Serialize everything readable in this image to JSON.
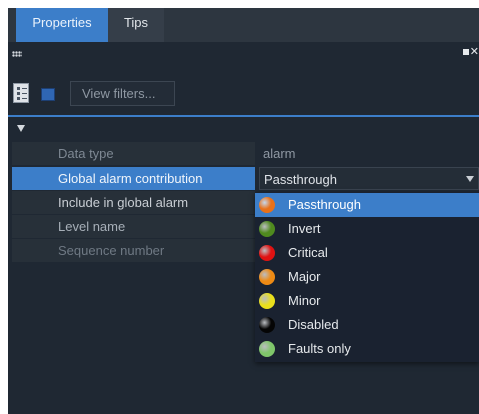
{
  "tabs": [
    {
      "label": "Properties",
      "active": true
    },
    {
      "label": "Tips",
      "active": false
    }
  ],
  "toolbar": {
    "view_filters_label": "View filters..."
  },
  "properties": [
    {
      "label": "Data type",
      "value": "alarm"
    },
    {
      "label": "Global alarm contribution",
      "value": "Passthrough"
    },
    {
      "label": "Include in global alarm",
      "value": ""
    },
    {
      "label": "Level name",
      "value": ""
    },
    {
      "label": "Sequence number",
      "value": ""
    }
  ],
  "dropdown": {
    "selected": "Passthrough",
    "options": [
      {
        "label": "Passthrough",
        "color": "#e8711a"
      },
      {
        "label": "Invert",
        "color": "#4f8a1e"
      },
      {
        "label": "Critical",
        "color": "#e01212"
      },
      {
        "label": "Major",
        "color": "#ee8a14"
      },
      {
        "label": "Minor",
        "color": "#e9df1c"
      },
      {
        "label": "Disabled",
        "color": "#050505"
      },
      {
        "label": "Faults only",
        "color": "#7fc66a"
      }
    ]
  },
  "colors": {
    "accent": "#3c7ec9",
    "background": "#1f2833"
  }
}
